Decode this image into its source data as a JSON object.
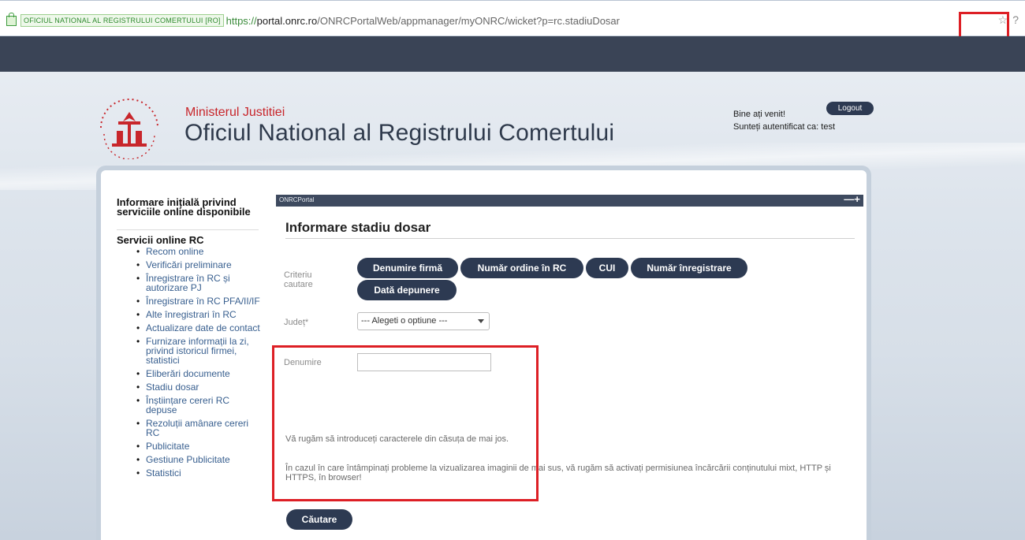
{
  "browser": {
    "site_identity": "OFICIUL NATIONAL AL REGISTRULUI COMERTULUI [RO]",
    "url_scheme": "https://",
    "url_host": "portal.onrc.ro",
    "url_path": "/ONRCPortalWeb/appmanager/myONRC/wicket?p=rc.stadiuDosar",
    "icons": [
      "star-icon",
      "help-icon"
    ]
  },
  "header": {
    "ministry": "Ministerul Justitiei",
    "office": "Oficiul National al Registrului Comertului",
    "welcome": "Bine ați venit!",
    "logout": "Logout",
    "auth_line": "Sunteți autentificat ca: test"
  },
  "sidebar": {
    "title": "Informare inițială privind serviciile online disponibile",
    "subtitle": "Servicii online RC",
    "items": [
      "Recom online",
      "Verificări preliminare",
      "Înregistrare în RC și autorizare PJ",
      "Înregistrare în RC PFA/II/IF",
      "Alte înregistrari în RC",
      "Actualizare date de contact",
      "Furnizare informații la zi, privind istoricul firmei, statistici",
      "Eliberări documente",
      "Stadiu dosar",
      "Înștiințare cereri RC depuse",
      "Rezoluții amânare cereri RC",
      "Publicitate",
      "Gestiune Publicitate",
      "Statistici"
    ]
  },
  "portlet": {
    "label": "ONRCPortal",
    "controls": "—+",
    "title": "Informare stadiu dosar",
    "criteria_label": "Criteriu cautare",
    "criteria": [
      "Denumire firmă",
      "Număr ordine în RC",
      "CUI",
      "Număr înregistrare",
      "Dată depunere"
    ],
    "county_label": "Județ*",
    "county_value": "--- Alegeti o optiune ---",
    "name_label": "Denumire",
    "name_value": "",
    "info1": "Vă rugăm să introduceți caracterele din căsuța de mai jos.",
    "info2": "În cazul în care întâmpinați probleme la vizualizarea imaginii de mai sus, vă rugăm să activați permisiunea încărcării conținutului mixt, HTTP și HTTPS, în browser!",
    "search_button": "Căutare"
  },
  "colors": {
    "brand_dark": "#2d3a52",
    "header_band": "#3a4456",
    "ministry_red": "#c8262b",
    "highlight_red": "#dd1f25"
  }
}
